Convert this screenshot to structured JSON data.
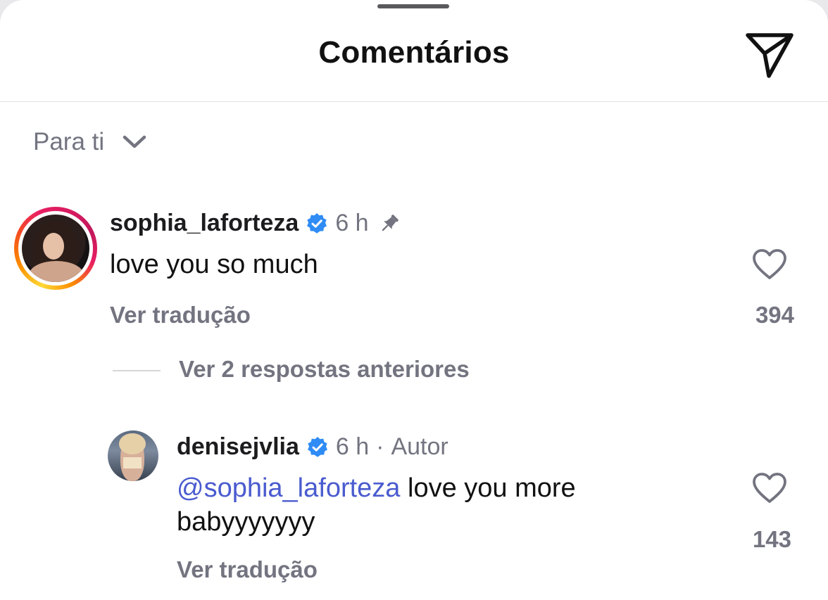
{
  "header": {
    "title": "Comentários"
  },
  "sort": {
    "label": "Para ti"
  },
  "comments": [
    {
      "username": "sophia_laforteza",
      "time": "6 h",
      "pinned": true,
      "text": "love you so much",
      "translate_label": "Ver tradução",
      "likes": "394"
    }
  ],
  "replies_link": "Ver 2 respostas anteriores",
  "reply": {
    "username": "denisejvlia",
    "time": "6 h",
    "separator": "·",
    "author_label": "Autor",
    "mention": "@sophia_laforteza",
    "text_line1": " love you more",
    "text_line2": "babyyyyyyy",
    "translate_label": "Ver tradução",
    "likes": "143"
  },
  "icons": {
    "share": "paper-plane-icon",
    "chevron": "chevron-down-icon",
    "verified": "verified-badge-icon",
    "pin": "pin-icon",
    "like": "heart-icon"
  },
  "colors": {
    "verified": "#2f8cf5",
    "mention": "#4a5bcf",
    "secondary_text": "#737480"
  }
}
